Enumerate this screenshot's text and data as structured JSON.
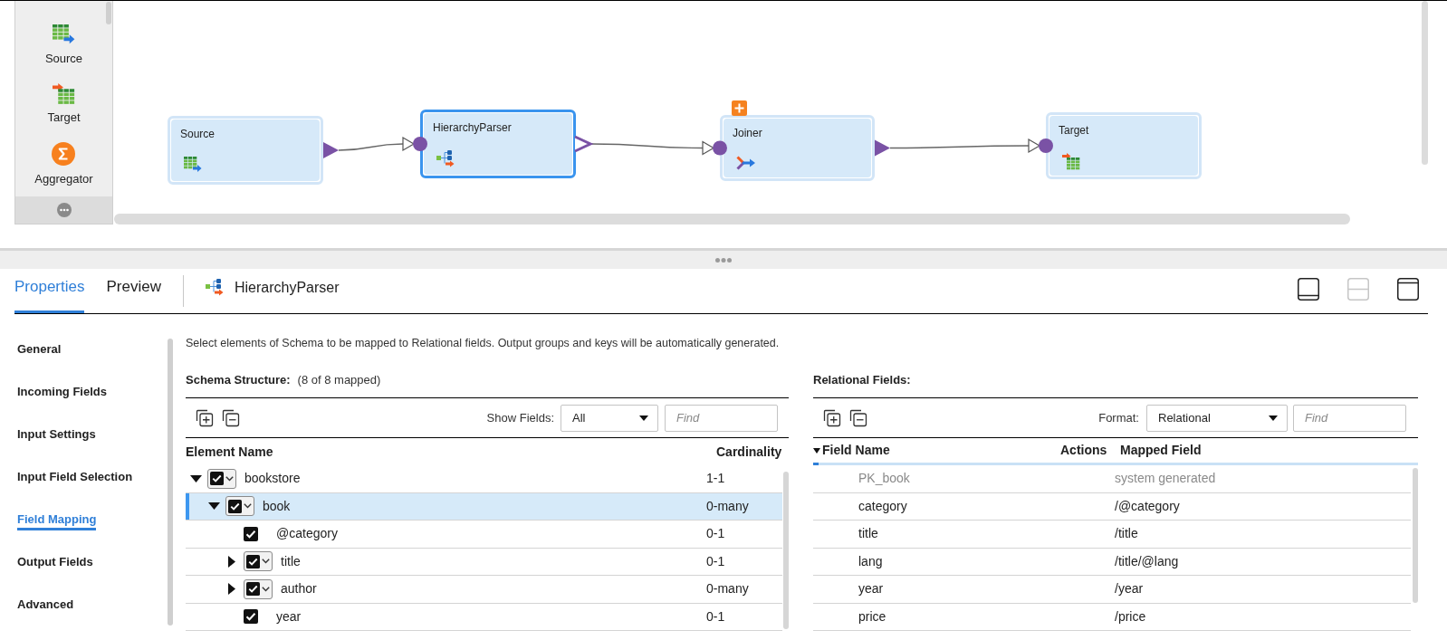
{
  "palette": {
    "items": [
      {
        "label": "Source",
        "kind": "source"
      },
      {
        "label": "Target",
        "kind": "target"
      },
      {
        "label": "Aggregator",
        "kind": "aggregator"
      }
    ]
  },
  "canvas": {
    "nodes": [
      {
        "label": "Source",
        "kind": "source",
        "selected": false,
        "badge": false,
        "output_port": {
          "kind": "filled"
        }
      },
      {
        "label": "HierarchyParser",
        "kind": "hierarchy_parser",
        "selected": true,
        "badge": false,
        "output_port": {
          "kind": "open"
        }
      },
      {
        "label": "Joiner",
        "kind": "joiner",
        "selected": false,
        "badge": true,
        "output_port": {
          "kind": "filled"
        }
      },
      {
        "label": "Target",
        "kind": "target",
        "selected": false,
        "badge": false
      }
    ]
  },
  "panel": {
    "tabs": [
      {
        "label": "Properties",
        "selected": true
      },
      {
        "label": "Preview",
        "selected": false
      }
    ],
    "object": {
      "label": "HierarchyParser",
      "kind": "hierarchy_parser"
    },
    "layout_buttons": [
      {
        "kind": "dock_bottom",
        "disabled": false
      },
      {
        "kind": "split",
        "disabled": true
      },
      {
        "kind": "dock_top",
        "disabled": false
      }
    ]
  },
  "nav": [
    {
      "label": "General",
      "selected": false
    },
    {
      "label": "Incoming Fields",
      "selected": false
    },
    {
      "label": "Input Settings",
      "selected": false
    },
    {
      "label": "Input Field Selection",
      "selected": false
    },
    {
      "label": "Field Mapping",
      "selected": true
    },
    {
      "label": "Output Fields",
      "selected": false
    },
    {
      "label": "Advanced",
      "selected": false
    }
  ],
  "description": "Select elements of Schema to be mapped to Relational fields. Output groups and keys will be automatically generated.",
  "schema": {
    "title": "Schema Structure:",
    "summary": "(8 of 8 mapped)",
    "filter_label": "Show Fields:",
    "filter_value": "All",
    "search": {
      "placeholder": "Find"
    },
    "columns": [
      "Element Name",
      "Cardinality"
    ],
    "rows": [
      {
        "name": "bookstore",
        "cardinality": "1-1",
        "kind": "group",
        "checked": true,
        "expanded": true,
        "selected": false,
        "children": [
          {
            "name": "book",
            "cardinality": "0-many",
            "kind": "group",
            "checked": true,
            "expanded": true,
            "selected": true,
            "children": [
              {
                "name": "@category",
                "cardinality": "0-1",
                "kind": "leaf",
                "checked": true,
                "selected": false
              },
              {
                "name": "title",
                "cardinality": "0-1",
                "kind": "group",
                "checked": true,
                "expanded": false,
                "selected": false
              },
              {
                "name": "author",
                "cardinality": "0-many",
                "kind": "group",
                "checked": true,
                "expanded": false,
                "selected": false
              },
              {
                "name": "year",
                "cardinality": "0-1",
                "kind": "leaf",
                "checked": true,
                "selected": false
              }
            ]
          }
        ]
      }
    ]
  },
  "relational": {
    "title": "Relational Fields:",
    "format_label": "Format:",
    "format_value": "Relational",
    "search": {
      "placeholder": "Find"
    },
    "columns": [
      "Field Name",
      "Actions",
      "Mapped Field"
    ],
    "rows": [
      {
        "field_name": "PK_book",
        "mapped_field": "system generated",
        "disabled": true
      },
      {
        "field_name": "category",
        "mapped_field": "/@category",
        "disabled": false
      },
      {
        "field_name": "title",
        "mapped_field": "/title",
        "disabled": false
      },
      {
        "field_name": "lang",
        "mapped_field": "/title/@lang",
        "disabled": false
      },
      {
        "field_name": "year",
        "mapped_field": "/year",
        "disabled": false
      },
      {
        "field_name": "price",
        "mapped_field": "/price",
        "disabled": false
      }
    ]
  }
}
